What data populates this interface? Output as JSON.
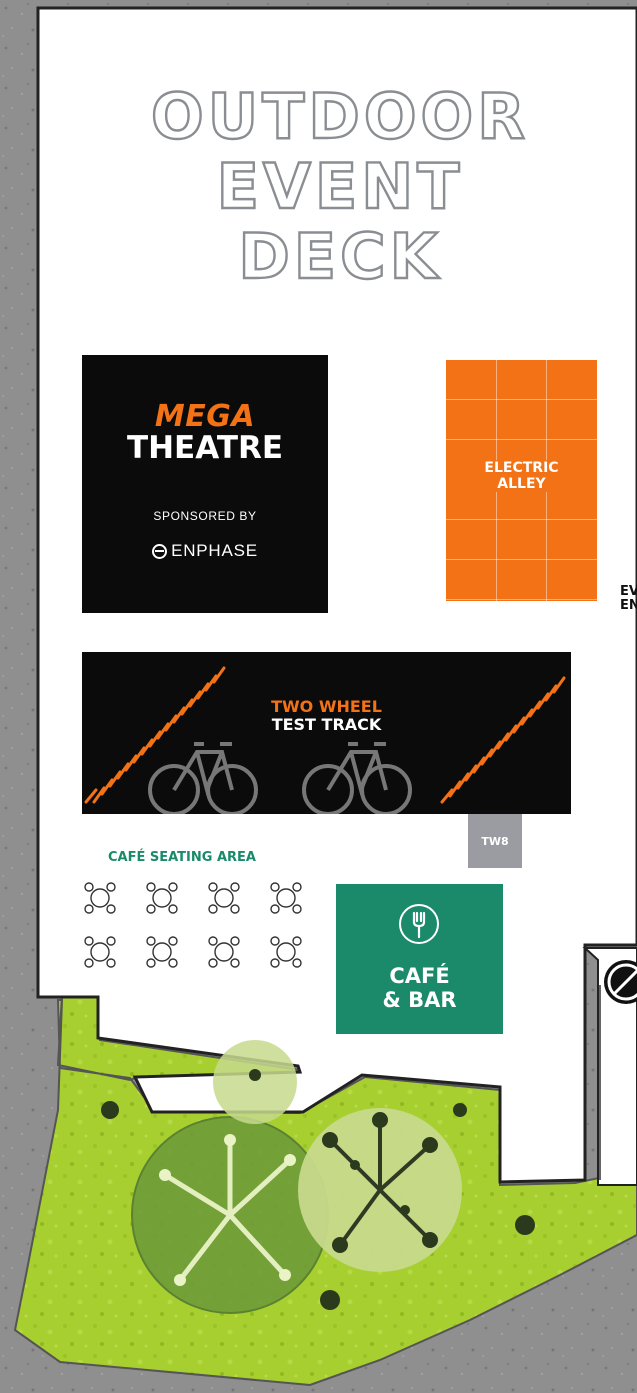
{
  "map": {
    "title": "OUTDOOR\nEVENT\nDECK",
    "zones": {
      "mega_theatre": {
        "line1": "MEGA",
        "line2": "THEATRE",
        "sponsored_by": "SPONSORED BY",
        "sponsor": "ENPHASE"
      },
      "electric_alley": {
        "label": "ELECTRIC\nALLEY"
      },
      "side_label": "EV\nEN",
      "test_track": {
        "line1": "TWO WHEEL",
        "line2": "TEST TRACK"
      },
      "tw8": "TW8",
      "cafe_seating": "CAFÉ SEATING AREA",
      "cafe_bar": {
        "line1": "CAFÉ",
        "line2": "& BAR"
      }
    },
    "colors": {
      "accent_orange": "#f47216",
      "cafe_green": "#1b8a6b",
      "grass": "#a6cf2f",
      "deck": "#ffffff"
    }
  }
}
